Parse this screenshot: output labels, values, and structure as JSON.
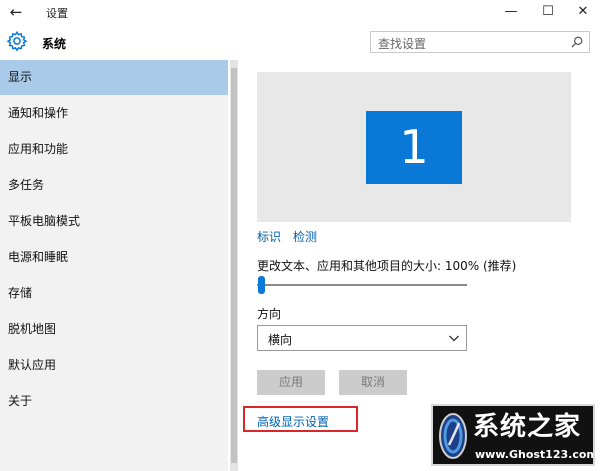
{
  "window": {
    "title": "设置",
    "back_glyph": "←",
    "minimize_glyph": "—",
    "maximize_glyph": "☐",
    "close_glyph": "✕"
  },
  "header": {
    "title": "系统",
    "icon": "gear-icon",
    "search_placeholder": "查找设置"
  },
  "sidebar": {
    "items": [
      {
        "label": "显示",
        "active": true
      },
      {
        "label": "通知和操作"
      },
      {
        "label": "应用和功能"
      },
      {
        "label": "多任务"
      },
      {
        "label": "平板电脑模式"
      },
      {
        "label": "电源和睡眠"
      },
      {
        "label": "存储"
      },
      {
        "label": "脱机地图"
      },
      {
        "label": "默认应用"
      },
      {
        "label": "关于"
      }
    ]
  },
  "display": {
    "monitor_number": "1",
    "identify_link": "标识",
    "detect_link": "检测",
    "scale_label": "更改文本、应用和其他项目的大小: 100% (推荐)",
    "scale_percent": 100,
    "orientation_label": "方向",
    "orientation_value": "横向",
    "apply_button": "应用",
    "cancel_button": "取消",
    "advanced_link": "高级显示设置"
  },
  "watermark": {
    "title": "系统之家",
    "url": "www.Ghost123.com"
  },
  "colors": {
    "accent": "#0a78d7",
    "sidebar_active": "#a9cbe9",
    "link": "#0063b1",
    "highlight_box": "#d8262b"
  }
}
